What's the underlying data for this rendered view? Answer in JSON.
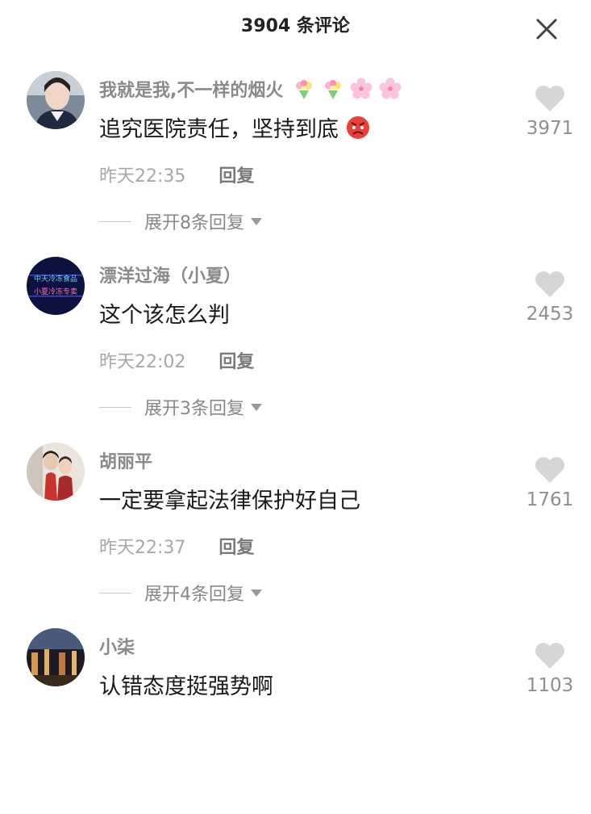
{
  "header": {
    "title": "3904 条评论"
  },
  "comments": [
    {
      "username": "我就是我,不一样的烟火",
      "text": "追究医院责任，坚持到底",
      "time": "昨天22:35",
      "reply": "回复",
      "expand": "展开8条回复",
      "likes": "3971",
      "name_emojis": [
        "bouquet-icon",
        "bouquet-icon",
        "cherry-blossom-icon",
        "cherry-blossom-icon"
      ],
      "text_emoji": "angry-face-icon"
    },
    {
      "username": "漂洋过海（小夏）",
      "text": "这个该怎么判",
      "time": "昨天22:02",
      "reply": "回复",
      "expand": "展开3条回复",
      "likes": "2453",
      "avatar_text": [
        "中天冷冻食品",
        "小夏冷冻专卖"
      ]
    },
    {
      "username": "胡丽平",
      "text": "一定要拿起法律保护好自己",
      "time": "昨天22:37",
      "reply": "回复",
      "expand": "展开4条回复",
      "likes": "1761"
    },
    {
      "username": "小柒",
      "text": "认错态度挺强势啊",
      "likes": "1103"
    }
  ],
  "colors": {
    "username": "#8a8a8a",
    "text": "#1a1a1a",
    "muted": "#a8a8a8",
    "heart": "#d6d6d6"
  }
}
